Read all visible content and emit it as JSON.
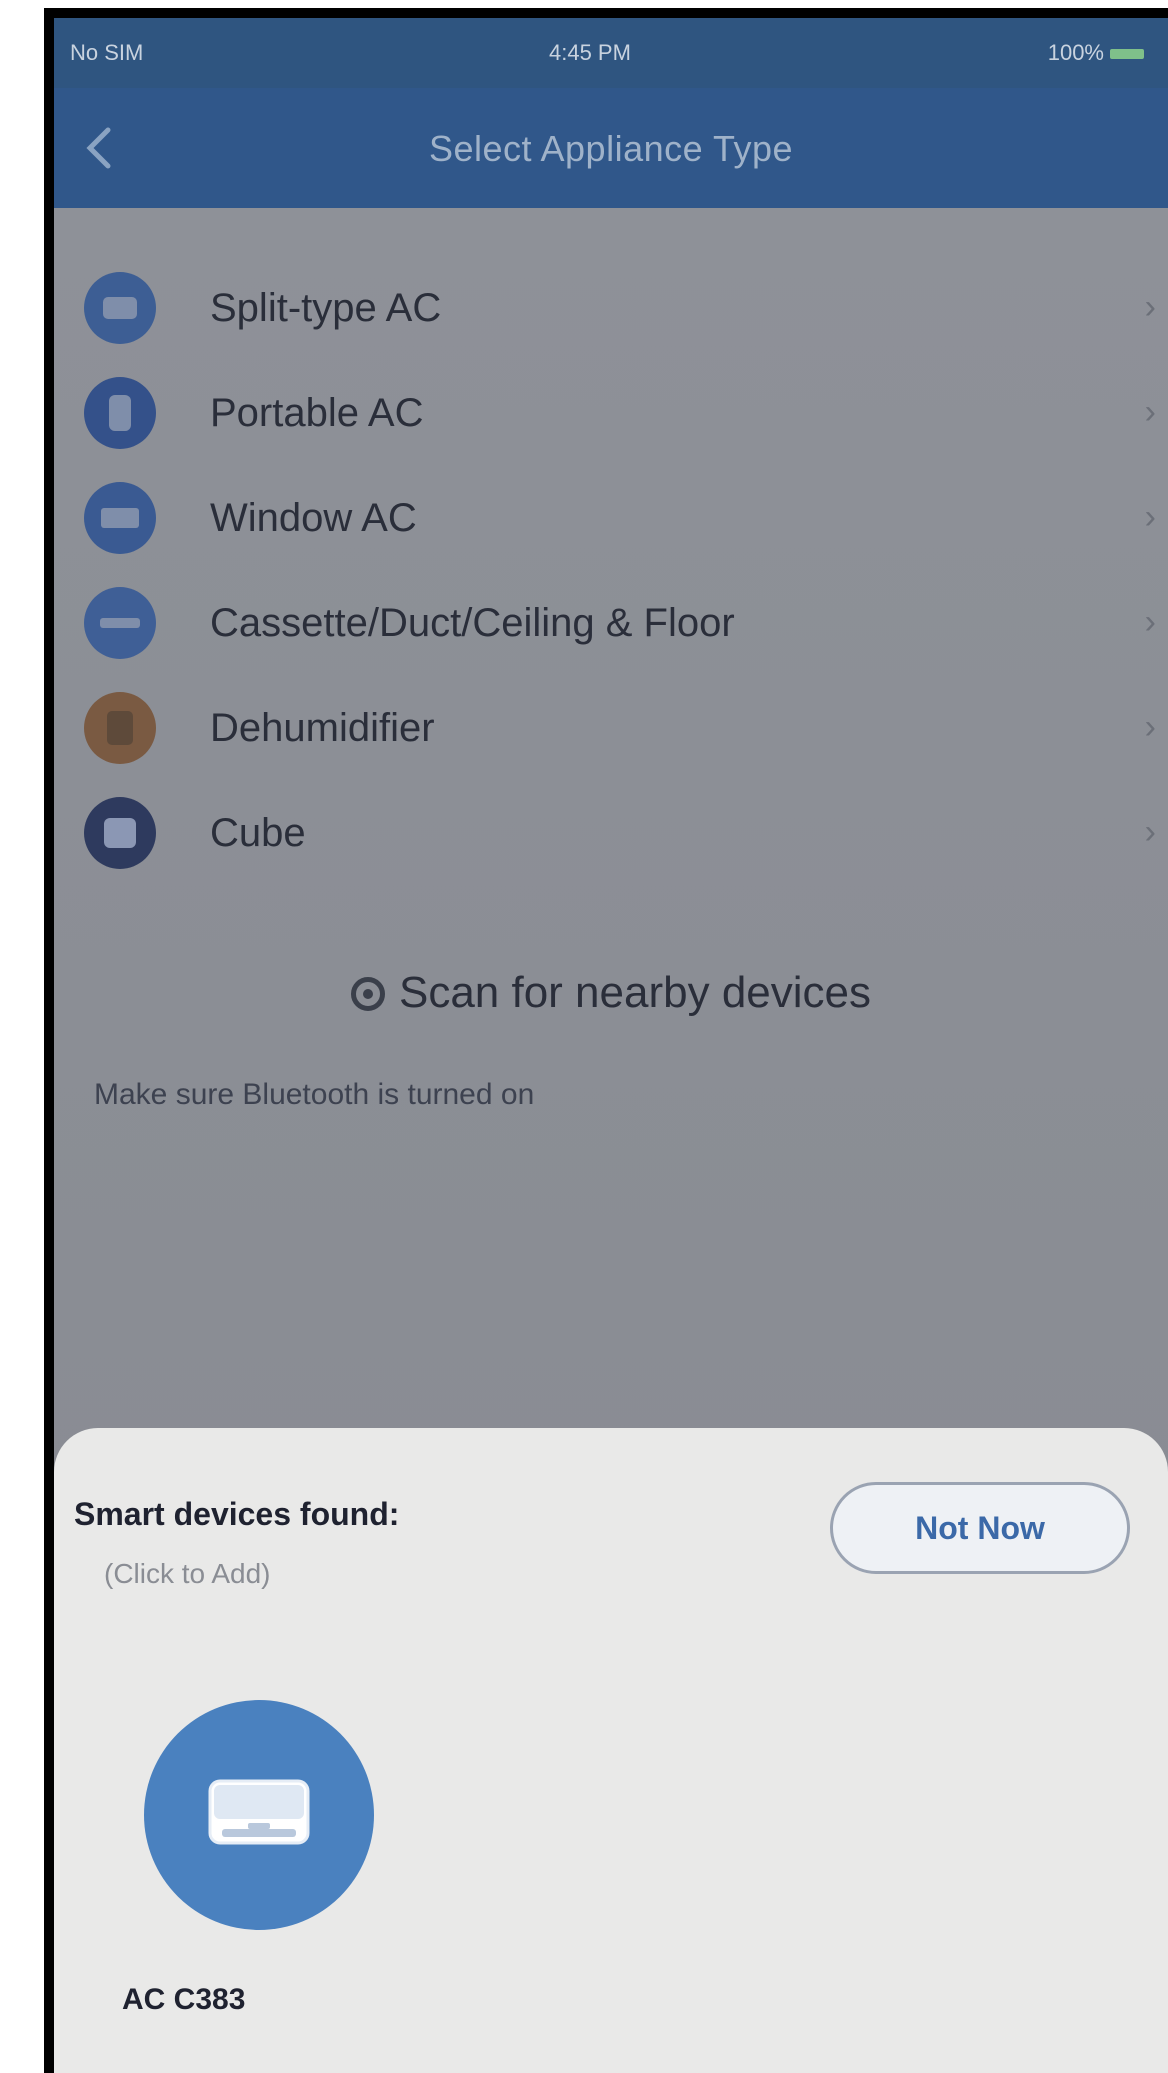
{
  "status_bar": {
    "carrier": "No SIM",
    "time": "4:45 PM",
    "battery": "100%"
  },
  "nav": {
    "title": "Select Appliance Type",
    "back_icon": "chevron-left-icon"
  },
  "appliances": [
    {
      "label": "Split-type AC",
      "icon": "split-ac-icon",
      "color": "#3d5e94"
    },
    {
      "label": "Portable AC",
      "icon": "portable-ac-icon",
      "color": "#34518a"
    },
    {
      "label": "Window AC",
      "icon": "window-ac-icon",
      "color": "#3a5a92"
    },
    {
      "label": "Cassette/Duct/Ceiling & Floor",
      "icon": "cassette-ac-icon",
      "color": "#3f5f96"
    },
    {
      "label": "Dehumidifier",
      "icon": "dehumidifier-icon",
      "color": "#7a5a42"
    },
    {
      "label": "Cube",
      "icon": "cube-icon",
      "color": "#2e3a5e"
    }
  ],
  "scan": {
    "label": "Scan for nearby devices",
    "icon": "scan-icon"
  },
  "hint_peek": "Make sure Bluetooth is turned on",
  "sheet": {
    "title": "Smart devices found:",
    "subtitle": "(Click to Add)",
    "not_now_label": "Not Now",
    "devices": [
      {
        "name": "AC C383",
        "icon": "ac-unit-icon",
        "color": "#4a81bf"
      }
    ]
  },
  "colors": {
    "nav_bar": "#30578a",
    "accent": "#3b69a8",
    "sheet_bg": "#e9e9e8"
  }
}
